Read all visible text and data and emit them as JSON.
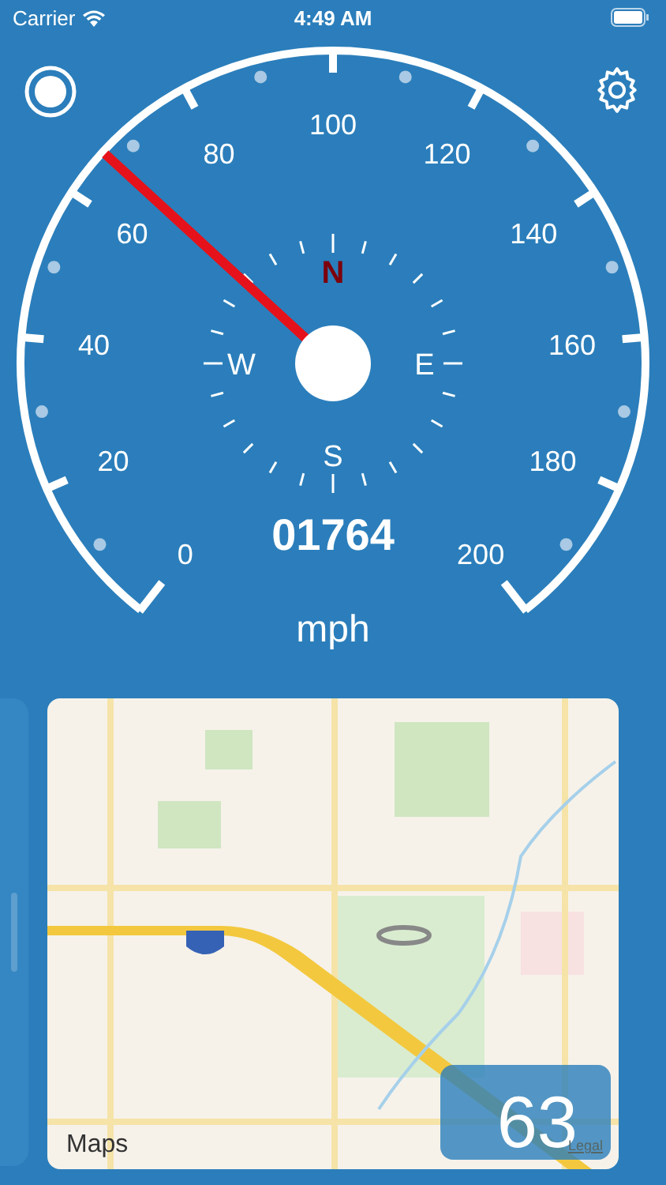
{
  "status_bar": {
    "carrier": "Carrier",
    "time": "4:49 AM"
  },
  "gauge": {
    "ticks": [
      "0",
      "20",
      "40",
      "60",
      "80",
      "100",
      "120",
      "140",
      "160",
      "180",
      "200"
    ],
    "compass": [
      {
        "label": "N",
        "kind": "north"
      },
      {
        "label": "E",
        "kind": "point"
      },
      {
        "label": "S",
        "kind": "point"
      },
      {
        "label": "W",
        "kind": "point"
      }
    ],
    "needle": {
      "level": 0.333
    },
    "odometer": "01764",
    "unit": "mph"
  },
  "map": {
    "kind": "picture",
    "attribution": "Maps",
    "speed": "63",
    "legal": "Legal"
  }
}
